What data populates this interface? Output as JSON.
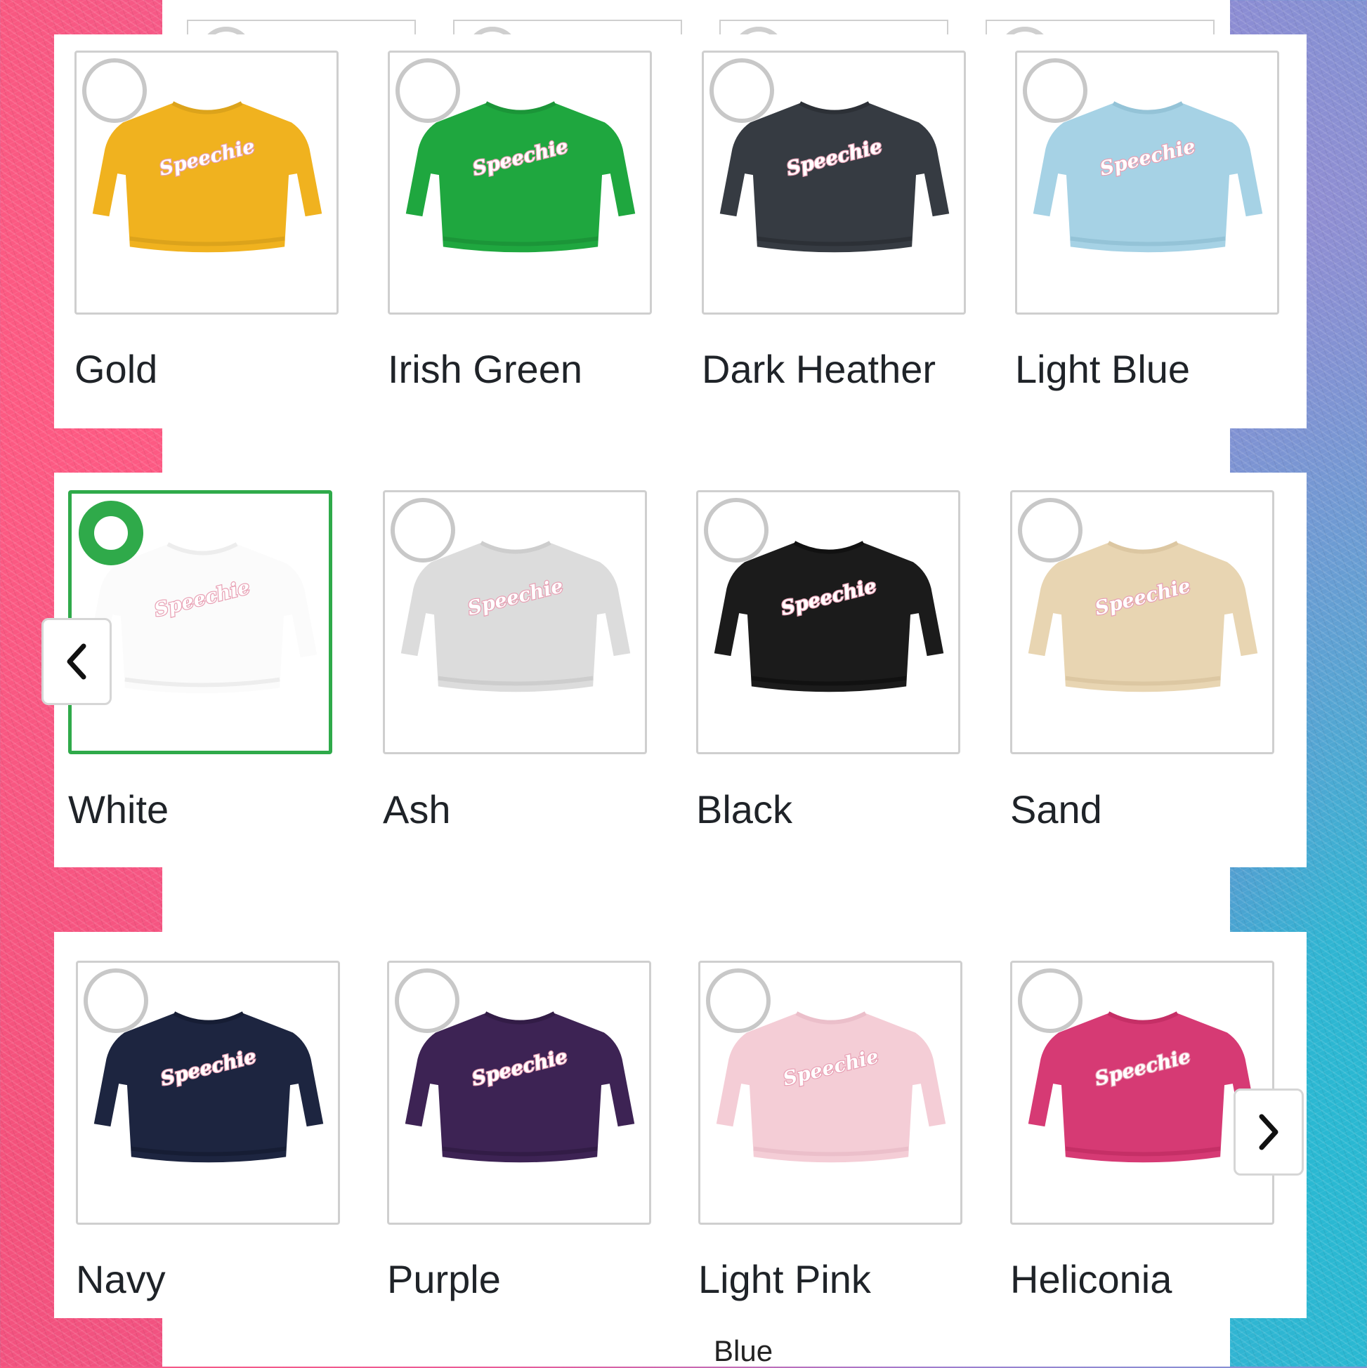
{
  "colors": {
    "selected_accent": "#2faa4a",
    "swatch_border": "#cfcfcf",
    "text": "#1f2328"
  },
  "background_card": {
    "partial_label": "Blue"
  },
  "rows": [
    {
      "swatches": [
        {
          "label": "Gold",
          "color": "#f0b21f",
          "trim": "#dca31b",
          "logo": "Speechie",
          "selected": false
        },
        {
          "label": "Irish Green",
          "color": "#1fa73f",
          "trim": "#1b9538",
          "logo": "Speechie",
          "selected": false
        },
        {
          "label": "Dark Heather",
          "color": "#363b42",
          "trim": "#2c3036",
          "logo": "Speechie",
          "selected": false
        },
        {
          "label": "Light Blue",
          "color": "#a6d2e5",
          "trim": "#94c3d7",
          "logo": "Speechie",
          "selected": false
        }
      ]
    },
    {
      "swatches": [
        {
          "label": "White",
          "color": "#fbfbfb",
          "trim": "#ededed",
          "logo": "Speechie",
          "selected": true
        },
        {
          "label": "Ash",
          "color": "#dcdcdc",
          "trim": "#cdcdcd",
          "logo": "Speechie",
          "selected": false
        },
        {
          "label": "Black",
          "color": "#1b1b1b",
          "trim": "#111111",
          "logo": "Speechie",
          "selected": false
        },
        {
          "label": "Sand",
          "color": "#e8d5b2",
          "trim": "#dcc7a2",
          "logo": "Speechie",
          "selected": false
        }
      ]
    },
    {
      "swatches": [
        {
          "label": "Navy",
          "color": "#1d2540",
          "trim": "#161d34",
          "logo": "Speechie",
          "selected": false
        },
        {
          "label": "Purple",
          "color": "#3d2354",
          "trim": "#321c46",
          "logo": "Speechie",
          "selected": false
        },
        {
          "label": "Light Pink",
          "color": "#f4cdd6",
          "trim": "#ebbfca",
          "logo": "Speechie",
          "selected": false
        },
        {
          "label": "Heliconia",
          "color": "#d63a74",
          "trim": "#c52f66",
          "logo": "Speechie",
          "selected": false
        }
      ]
    }
  ],
  "icons": {
    "prev": "chevron-left-icon",
    "next": "chevron-right-icon"
  }
}
